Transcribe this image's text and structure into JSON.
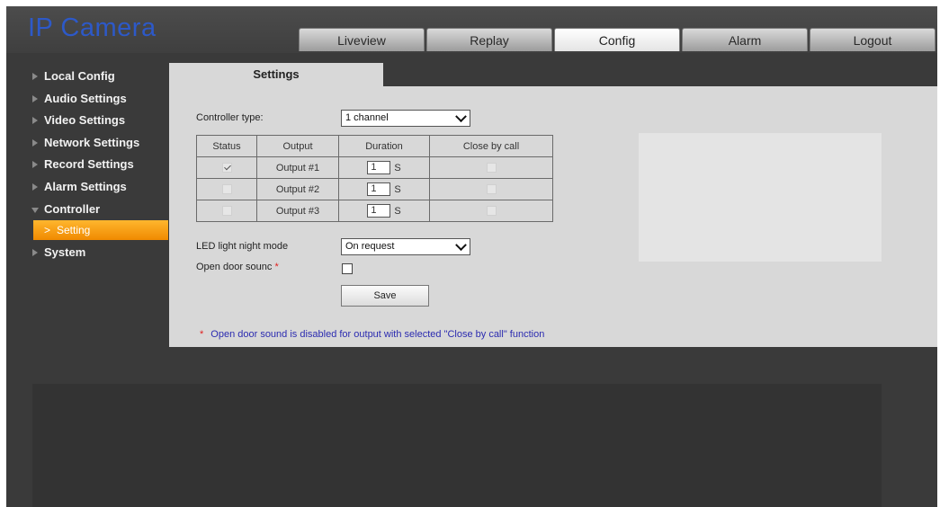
{
  "app": {
    "logo": "IP Camera"
  },
  "nav_tabs": [
    {
      "label": "Liveview"
    },
    {
      "label": "Replay"
    },
    {
      "label": "Config",
      "active": true
    },
    {
      "label": "Alarm"
    },
    {
      "label": "Logout"
    }
  ],
  "sidebar": {
    "items": [
      {
        "label": "Local Config"
      },
      {
        "label": "Audio Settings"
      },
      {
        "label": "Video Settings"
      },
      {
        "label": "Network Settings"
      },
      {
        "label": "Record Settings"
      },
      {
        "label": "Alarm Settings"
      },
      {
        "label": "Controller",
        "expanded": true
      },
      {
        "label": "System"
      }
    ],
    "sub_item": {
      "label": "Setting",
      "chevron": ">"
    }
  },
  "content": {
    "tab_title": "Settings",
    "controller_type": {
      "label": "Controller type:",
      "value": "1 channel"
    },
    "table": {
      "headers": [
        "Status",
        "Output",
        "Duration",
        "Close by call"
      ],
      "rows": [
        {
          "status_checked": true,
          "output": "Output #1",
          "duration": "1",
          "unit": "S",
          "close_by_call": false
        },
        {
          "status_checked": false,
          "output": "Output #2",
          "duration": "1",
          "unit": "S",
          "close_by_call": false
        },
        {
          "status_checked": false,
          "output": "Output #3",
          "duration": "1",
          "unit": "S",
          "close_by_call": false
        }
      ]
    },
    "led_mode": {
      "label": "LED light night mode",
      "value": "On request"
    },
    "open_door_sound": {
      "label": "Open door sounc",
      "required_mark": "*",
      "checked": false
    },
    "save_label": "Save",
    "note": {
      "mark": "*",
      "text": "Open door sound is disabled for output with selected \"Close by call\" function"
    }
  },
  "colors": {
    "logo": "#2d59c8",
    "background": "#3a3a3a",
    "panel": "#d8d8d8",
    "accent": "#f08a00",
    "note_text": "#2b2bb0",
    "required_mark": "#e0201f"
  }
}
